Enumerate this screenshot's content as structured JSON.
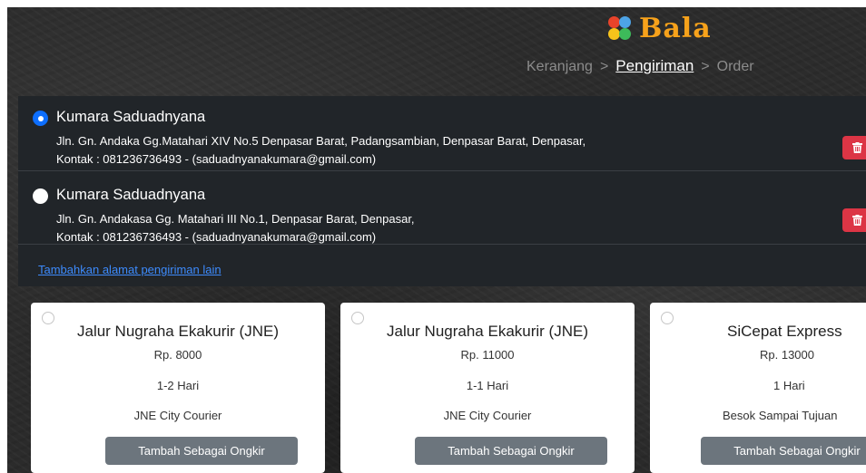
{
  "brand": {
    "name": "Bala",
    "color": "#f7a21b",
    "dot_colors": [
      "#e8432a",
      "#4da3e6",
      "#f7c31b",
      "#3dbb5a"
    ]
  },
  "breadcrumb": {
    "step1": "Keranjang",
    "sep1": ">",
    "step2": "Pengiriman",
    "sep2": ">",
    "step3": "Order",
    "active_step": "Pengiriman"
  },
  "addresses": [
    {
      "name": "Kumara Saduadnyana",
      "selected": true,
      "line1": "Jln. Gn. Andaka Gg.Matahari XIV No.5 Denpasar Barat, Padangsambian, Denpasar Barat, Denpasar,",
      "line2": "Kontak : 081236736493 - (saduadnyanakumara@gmail.com)",
      "delete_icon": "trash-icon"
    },
    {
      "name": "Kumara Saduadnyana",
      "selected": false,
      "line1": "Jln. Gn. Andakasa Gg. Matahari III No.1, Denpasar Barat, Denpasar,",
      "line2": "Kontak : 081236736493 - (saduadnyanakumara@gmail.com)",
      "delete_icon": "trash-icon"
    }
  ],
  "add_address_link": "Tambahkan alamat pengiriman lain",
  "couriers": [
    {
      "name": "Jalur Nugraha Ekakurir (JNE)",
      "price": "Rp. 8000",
      "days": "1-2 Hari",
      "service": "JNE City Courier",
      "button": "Tambah Sebagai Ongkir"
    },
    {
      "name": "Jalur Nugraha Ekakurir (JNE)",
      "price": "Rp. 11000",
      "days": "1-1 Hari",
      "service": "JNE City Courier",
      "button": "Tambah Sebagai Ongkir"
    },
    {
      "name": "SiCepat Express",
      "price": "Rp. 13000",
      "days": "1 Hari",
      "service": "Besok Sampai Tujuan",
      "button": "Tambah Sebagai Ongkir"
    }
  ],
  "colors": {
    "danger": "#dc3545",
    "primary": "#0d6efd",
    "link": "#3d8bfd",
    "secondary": "#6c757d",
    "panel": "#212529"
  }
}
